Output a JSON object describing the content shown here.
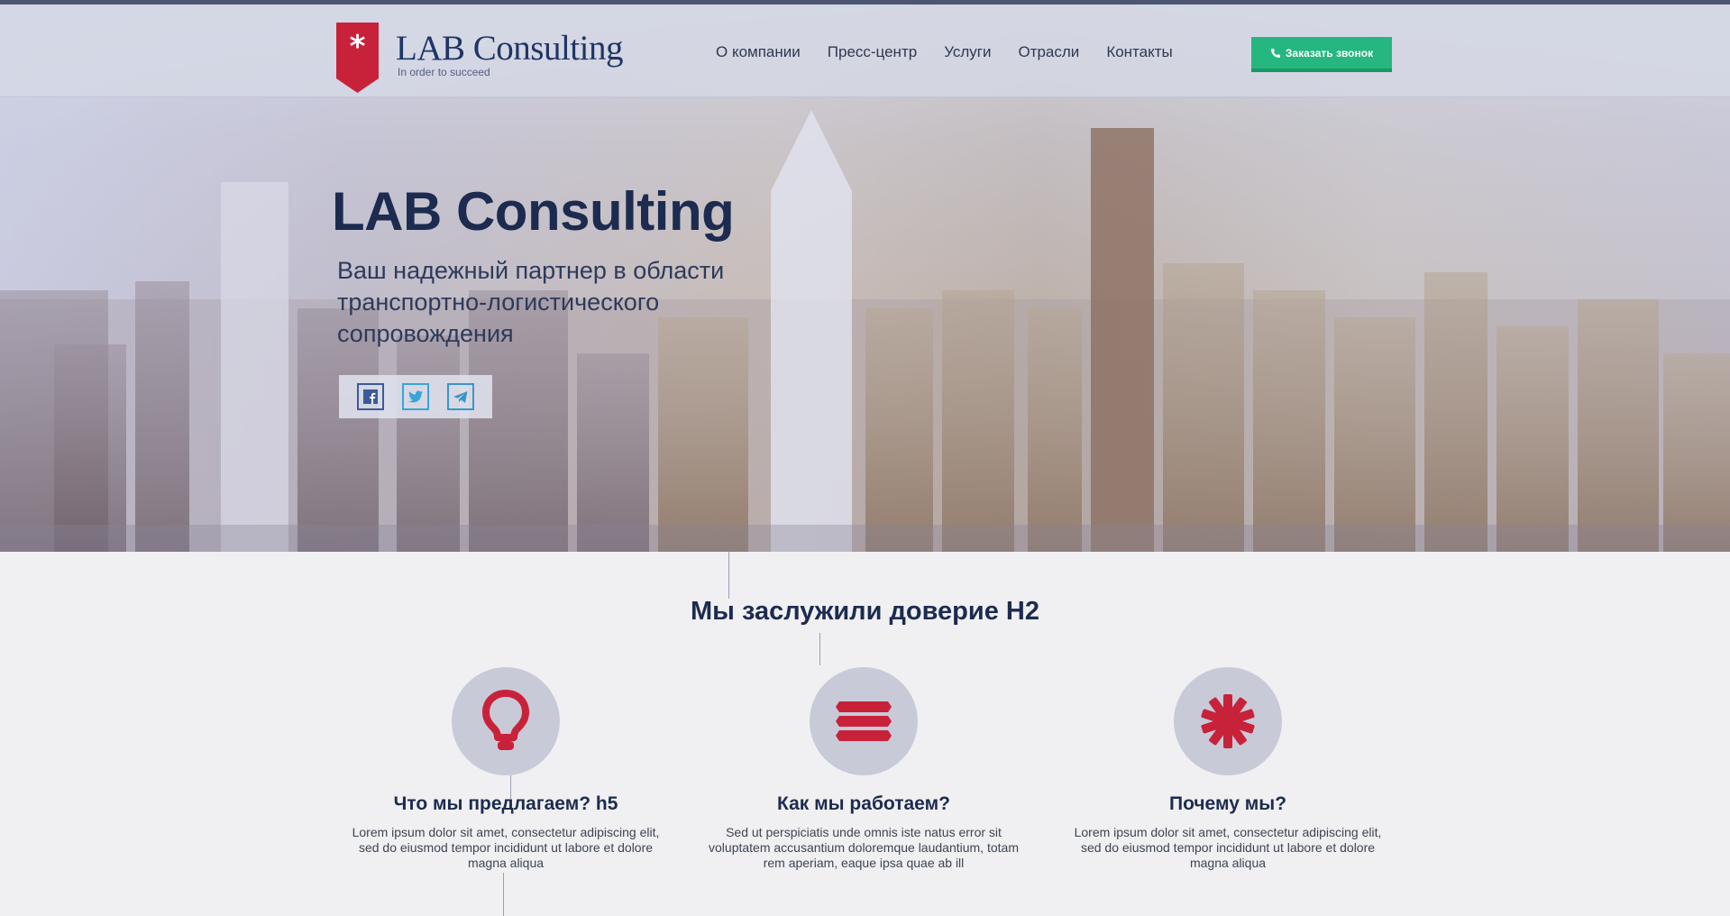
{
  "header": {
    "logo_title": "LAB Consulting",
    "logo_tagline": "In order to succeed",
    "nav": [
      "О компании",
      "Пресс-центр",
      "Услуги",
      "Отрасли",
      "Контакты"
    ],
    "call_button": "Заказать звонок"
  },
  "hero": {
    "title": "LAB Consulting",
    "subtitle_lines": [
      "Ваш надежный партнер в области",
      "транспортно-логистического",
      "сопровождения"
    ],
    "social_icons": [
      "facebook-icon",
      "twitter-icon",
      "telegram-icon"
    ]
  },
  "section": {
    "title": "Мы заслужили доверие H2"
  },
  "features": [
    {
      "icon": "lightbulb-icon",
      "title": "Что мы предлагаем? h5",
      "text": "Lorem ipsum dolor sit amet, consectetur adipiscing elit, sed do eiusmod tempor incididunt ut labore et dolore magna aliqua"
    },
    {
      "icon": "layers-icon",
      "title": "Как мы работаем?",
      "text": "Sed ut perspiciatis unde omnis iste natus error sit voluptatem accusantium doloremque laudantium, totam rem aperiam, eaque ipsa quae ab ill"
    },
    {
      "icon": "asterisk-icon",
      "title": "Почему мы?",
      "text": "Lorem ipsum dolor sit amet, consectetur adipiscing elit, sed do eiusmod tempor incididunt ut labore et dolore magna aliqua"
    }
  ],
  "colors": {
    "brand_red": "#c8223a",
    "brand_navy": "#1c2b4f",
    "button_green": "#26b67f"
  }
}
